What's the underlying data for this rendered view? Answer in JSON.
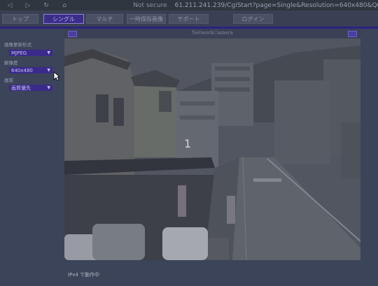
{
  "browser": {
    "security_label": "Not secure",
    "address": "61.211.241.239/CgiStart?page=Single&Resolution=640x480&Qu",
    "back_icon": "arrow-left-icon",
    "forward_icon": "arrow-right-icon",
    "reload_icon": "reload-icon",
    "home_icon": "home-icon"
  },
  "nav": {
    "tabs": [
      {
        "label": "トップ",
        "active": false
      },
      {
        "label": "シングル",
        "active": true
      },
      {
        "label": "マルチ",
        "active": false
      },
      {
        "label": "一時保存画像",
        "active": false
      },
      {
        "label": "サポート",
        "active": false
      },
      {
        "label": "ログイン",
        "active": false
      }
    ]
  },
  "sidebar": {
    "fields": [
      {
        "label": "画像更新形式",
        "value": "MJPEG"
      },
      {
        "label": "解像度",
        "value": "640x480"
      },
      {
        "label": "画質",
        "value": "画質優先"
      }
    ]
  },
  "camera": {
    "title": "NetworkCamera",
    "number": "1",
    "left_icon": "camera-icon",
    "right_icon": "save-icon"
  },
  "status": {
    "text": "IPv4 で動作中"
  },
  "colors": {
    "accent": "#2c2280",
    "select_bg": "#3a2a8c",
    "page_bg": "#3b4458"
  }
}
